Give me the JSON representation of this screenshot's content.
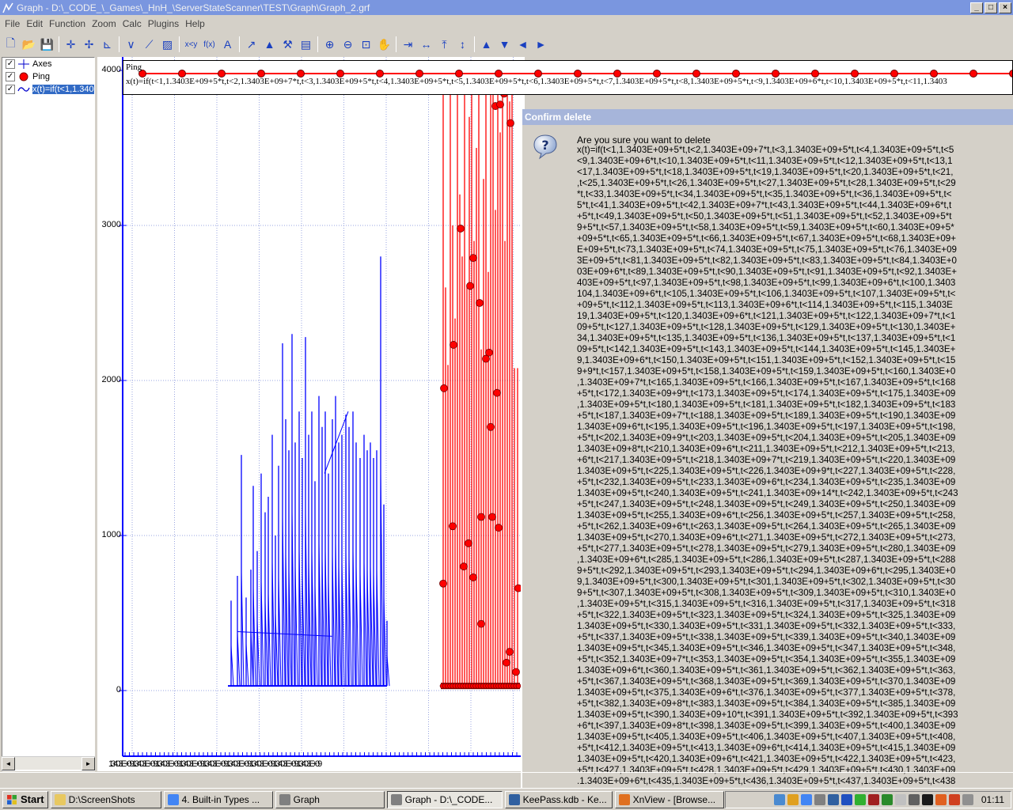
{
  "window": {
    "title": "Graph - D:\\_CODE_\\_Games\\_HnH_\\ServerStateScanner\\TEST\\Graph\\Graph_2.grf",
    "btn_min": "_",
    "btn_max": "□",
    "btn_close": "×"
  },
  "menu": [
    "File",
    "Edit",
    "Function",
    "Zoom",
    "Calc",
    "Plugins",
    "Help"
  ],
  "toolbar": [
    {
      "name": "new-file-icon",
      "glyph": "🗋"
    },
    {
      "name": "open-folder-icon",
      "glyph": "📂"
    },
    {
      "name": "save-icon",
      "glyph": "💾"
    },
    {
      "sep": true
    },
    {
      "name": "axes-icon",
      "glyph": "✛"
    },
    {
      "name": "grid-axes-icon",
      "glyph": "✢"
    },
    {
      "name": "axes-graph-icon",
      "glyph": "⊾"
    },
    {
      "sep": true
    },
    {
      "name": "insert-function-icon",
      "glyph": "∨"
    },
    {
      "name": "insert-tangent-icon",
      "glyph": "⟋"
    },
    {
      "name": "insert-shading-icon",
      "glyph": "▨"
    },
    {
      "sep": true
    },
    {
      "name": "insert-relation-icon",
      "glyph": "x<y"
    },
    {
      "name": "insert-fx-icon",
      "glyph": "f(x)"
    },
    {
      "name": "insert-label-icon",
      "glyph": "A"
    },
    {
      "sep": true
    },
    {
      "name": "trendline-icon",
      "glyph": "↗"
    },
    {
      "name": "point-series-icon",
      "glyph": "▲"
    },
    {
      "name": "custom-icon",
      "glyph": "⚒"
    },
    {
      "name": "table-icon",
      "glyph": "▤"
    },
    {
      "sep": true
    },
    {
      "name": "zoom-in-icon",
      "glyph": "⊕"
    },
    {
      "name": "zoom-out-icon",
      "glyph": "⊖"
    },
    {
      "name": "zoom-window-icon",
      "glyph": "⊡"
    },
    {
      "name": "pan-hand-icon",
      "glyph": "✋"
    },
    {
      "sep": true
    },
    {
      "name": "zoom-x-in-icon",
      "glyph": "⇥"
    },
    {
      "name": "zoom-x-out-icon",
      "glyph": "↔"
    },
    {
      "name": "zoom-y-in-icon",
      "glyph": "⤒"
    },
    {
      "name": "zoom-y-out-icon",
      "glyph": "↕"
    },
    {
      "sep": true
    },
    {
      "name": "move-up-icon",
      "glyph": "▲"
    },
    {
      "name": "move-down-icon",
      "glyph": "▼"
    },
    {
      "name": "move-left-icon",
      "glyph": "◄"
    },
    {
      "name": "move-right-icon",
      "glyph": "►"
    }
  ],
  "legend": [
    {
      "label": "Axes",
      "checked": "✓",
      "icon": "axes-icon"
    },
    {
      "label": "Ping",
      "checked": "✓",
      "icon": "red-dot-icon"
    },
    {
      "label": "x(t)=if(t<1,1.3403",
      "checked": "✓",
      "icon": "wave-icon"
    }
  ],
  "colors": {
    "series_blue": "#0000ff",
    "series_red": "#ff0000",
    "axis": "#0000ff"
  },
  "tooltip": {
    "name": "Ping",
    "expression": "x(t)=if(t<1,1.3403E+09+5*t,t<2,1.3403E+09+7*t,t<3,1.3403E+09+5*t,t<4,1.3403E+09+5*t,t<5,1.3403E+09+5*t,t<6,1.3403E+09+5*t,t<7,1.3403E+09+5*t,t<8,1.3403E+09+5*t,t<9,1.3403E+09+6*t,t<10,1.3403E+09+5*t,t<11,1.3403"
  },
  "chart_data": {
    "type": "scatter",
    "y_ticks": [
      "4000",
      "3000",
      "2000",
      "1000",
      "0"
    ],
    "x_tick_text": "1.3403E+09 1.3403E+09 1.3403E+09 1.3403E+09 1.3403E+09 1.3403E+09 1.3403E+09 1.3403E+09 1.3403E+09",
    "ylim": [
      -420,
      4000
    ],
    "grid": true,
    "blue_spikes": [
      [
        292,
        580
      ],
      [
        300,
        740
      ],
      [
        305,
        1520
      ],
      [
        311,
        600
      ],
      [
        317,
        780
      ],
      [
        320,
        1320
      ],
      [
        325,
        900
      ],
      [
        330,
        1400
      ],
      [
        335,
        1150
      ],
      [
        339,
        1250
      ],
      [
        344,
        1650
      ],
      [
        348,
        1000
      ],
      [
        352,
        1450
      ],
      [
        357,
        2240
      ],
      [
        361,
        1750
      ],
      [
        365,
        1550
      ],
      [
        369,
        2300
      ],
      [
        373,
        1600
      ],
      [
        378,
        1800
      ],
      [
        382,
        1500
      ],
      [
        386,
        2280
      ],
      [
        390,
        1650
      ],
      [
        394,
        1800
      ],
      [
        398,
        1350
      ],
      [
        403,
        1900
      ],
      [
        407,
        1700
      ],
      [
        411,
        1800
      ],
      [
        415,
        1400
      ],
      [
        420,
        1750
      ],
      [
        424,
        1900
      ],
      [
        428,
        1600
      ],
      [
        432,
        1650
      ],
      [
        437,
        1780
      ],
      [
        441,
        1700
      ],
      [
        446,
        1800
      ],
      [
        450,
        1600
      ],
      [
        455,
        1500
      ],
      [
        460,
        1650
      ],
      [
        464,
        1550
      ],
      [
        468,
        1600
      ],
      [
        472,
        1500
      ],
      [
        476,
        1550
      ],
      [
        481,
        2800
      ],
      [
        485,
        1200
      ],
      [
        489,
        450
      ]
    ],
    "red_points": [
      [
        561,
        1950
      ],
      [
        560,
        690
      ],
      [
        572,
        1060
      ],
      [
        573,
        2230
      ],
      [
        582,
        2980
      ],
      [
        586,
        800
      ],
      [
        592,
        950
      ],
      [
        594,
        2610
      ],
      [
        598,
        2790
      ],
      [
        598,
        730
      ],
      [
        606,
        2500
      ],
      [
        608,
        1120
      ],
      [
        608,
        430
      ],
      [
        614,
        2140
      ],
      [
        618,
        2180
      ],
      [
        620,
        1700
      ],
      [
        622,
        1120
      ],
      [
        626,
        3770
      ],
      [
        628,
        1920
      ],
      [
        630,
        1050
      ],
      [
        632,
        3780
      ],
      [
        637,
        3850
      ],
      [
        645,
        3660
      ],
      [
        644,
        250
      ],
      [
        640,
        180
      ],
      [
        652,
        120
      ],
      [
        655,
        660
      ]
    ],
    "red_spikes": [
      [
        560,
        4000
      ],
      [
        563,
        2600
      ],
      [
        566,
        2100
      ],
      [
        569,
        4000
      ],
      [
        572,
        3000
      ],
      [
        575,
        2400
      ],
      [
        578,
        4000
      ],
      [
        581,
        3200
      ],
      [
        584,
        2800
      ],
      [
        587,
        4000
      ],
      [
        590,
        2600
      ],
      [
        593,
        3700
      ],
      [
        596,
        4000
      ],
      [
        599,
        2900
      ],
      [
        602,
        3500
      ],
      [
        605,
        4000
      ],
      [
        608,
        2200
      ],
      [
        611,
        3300
      ],
      [
        614,
        4000
      ],
      [
        617,
        2700
      ],
      [
        620,
        3900
      ],
      [
        623,
        4000
      ],
      [
        626,
        3100
      ],
      [
        629,
        4000
      ],
      [
        632,
        3600
      ],
      [
        635,
        4000
      ],
      [
        638,
        2900
      ],
      [
        641,
        4000
      ],
      [
        644,
        3800
      ],
      [
        647,
        4000
      ],
      [
        650,
        2080
      ],
      [
        654,
        2080
      ]
    ]
  },
  "dialog": {
    "title": "Confirm delete",
    "message": "Are you sure you want to delete",
    "lines": [
      "x(t)=if(t<1,1.3403E+09+5*t,t<2,1.3403E+09+7*t,t<3,1.3403E+09+5*t,t<4,1.3403E+09+5*t,t<5",
      "<9,1.3403E+09+6*t,t<10,1.3403E+09+5*t,t<11,1.3403E+09+5*t,t<12,1.3403E+09+5*t,t<13,1",
      "<17,1.3403E+09+5*t,t<18,1.3403E+09+5*t,t<19,1.3403E+09+5*t,t<20,1.3403E+09+5*t,t<21,",
      ",t<25,1.3403E+09+5*t,t<26,1.3403E+09+5*t,t<27,1.3403E+09+5*t,t<28,1.3403E+09+5*t,t<29",
      "*t,t<33,1.3403E+09+5*t,t<34,1.3403E+09+5*t,t<35,1.3403E+09+5*t,t<36,1.3403E+09+5*t,t<",
      "5*t,t<41,1.3403E+09+5*t,t<42,1.3403E+09+7*t,t<43,1.3403E+09+5*t,t<44,1.3403E+09+6*t,t",
      "+5*t,t<49,1.3403E+09+5*t,t<50,1.3403E+09+5*t,t<51,1.3403E+09+5*t,t<52,1.3403E+09+5*t",
      "9+5*t,t<57,1.3403E+09+5*t,t<58,1.3403E+09+5*t,t<59,1.3403E+09+5*t,t<60,1.3403E+09+5*",
      "+09+5*t,t<65,1.3403E+09+5*t,t<66,1.3403E+09+5*t,t<67,1.3403E+09+5*t,t<68,1.3403E+09+",
      "E+09+5*t,t<73,1.3403E+09+5*t,t<74,1.3403E+09+5*t,t<75,1.3403E+09+5*t,t<76,1.3403E+09",
      "3E+09+5*t,t<81,1.3403E+09+5*t,t<82,1.3403E+09+5*t,t<83,1.3403E+09+5*t,t<84,1.3403E+0",
      "03E+09+6*t,t<89,1.3403E+09+5*t,t<90,1.3403E+09+5*t,t<91,1.3403E+09+5*t,t<92,1.3403E+",
      "403E+09+5*t,t<97,1.3403E+09+5*t,t<98,1.3403E+09+5*t,t<99,1.3403E+09+6*t,t<100,1.3403",
      "104,1.3403E+09+6*t,t<105,1.3403E+09+5*t,t<106,1.3403E+09+5*t,t<107,1.3403E+09+5*t,t<",
      "+09+5*t,t<112,1.3403E+09+5*t,t<113,1.3403E+09+6*t,t<114,1.3403E+09+5*t,t<115,1.3403E",
      "19,1.3403E+09+5*t,t<120,1.3403E+09+6*t,t<121,1.3403E+09+5*t,t<122,1.3403E+09+7*t,t<1",
      "09+5*t,t<127,1.3403E+09+5*t,t<128,1.3403E+09+5*t,t<129,1.3403E+09+5*t,t<130,1.3403E+",
      "34,1.3403E+09+5*t,t<135,1.3403E+09+5*t,t<136,1.3403E+09+5*t,t<137,1.3403E+09+5*t,t<1",
      "09+5*t,t<142,1.3403E+09+5*t,t<143,1.3403E+09+5*t,t<144,1.3403E+09+5*t,t<145,1.3403E+",
      "9,1.3403E+09+6*t,t<150,1.3403E+09+5*t,t<151,1.3403E+09+5*t,t<152,1.3403E+09+5*t,t<15",
      "9+9*t,t<157,1.3403E+09+5*t,t<158,1.3403E+09+5*t,t<159,1.3403E+09+5*t,t<160,1.3403E+0",
      ",1.3403E+09+7*t,t<165,1.3403E+09+5*t,t<166,1.3403E+09+5*t,t<167,1.3403E+09+5*t,t<168",
      "+5*t,t<172,1.3403E+09+9*t,t<173,1.3403E+09+5*t,t<174,1.3403E+09+5*t,t<175,1.3403E+09",
      ",1.3403E+09+5*t,t<180,1.3403E+09+5*t,t<181,1.3403E+09+5*t,t<182,1.3403E+09+5*t,t<183",
      "+5*t,t<187,1.3403E+09+7*t,t<188,1.3403E+09+5*t,t<189,1.3403E+09+5*t,t<190,1.3403E+09",
      "1.3403E+09+6*t,t<195,1.3403E+09+5*t,t<196,1.3403E+09+5*t,t<197,1.3403E+09+5*t,t<198,",
      "+5*t,t<202,1.3403E+09+9*t,t<203,1.3403E+09+5*t,t<204,1.3403E+09+5*t,t<205,1.3403E+09",
      "1.3403E+09+8*t,t<210,1.3403E+09+6*t,t<211,1.3403E+09+5*t,t<212,1.3403E+09+5*t,t<213,",
      "+6*t,t<217,1.3403E+09+5*t,t<218,1.3403E+09+7*t,t<219,1.3403E+09+5*t,t<220,1.3403E+09",
      "1.3403E+09+5*t,t<225,1.3403E+09+5*t,t<226,1.3403E+09+9*t,t<227,1.3403E+09+5*t,t<228,",
      "+5*t,t<232,1.3403E+09+5*t,t<233,1.3403E+09+6*t,t<234,1.3403E+09+5*t,t<235,1.3403E+09",
      "1.3403E+09+5*t,t<240,1.3403E+09+5*t,t<241,1.3403E+09+14*t,t<242,1.3403E+09+5*t,t<243",
      "+5*t,t<247,1.3403E+09+5*t,t<248,1.3403E+09+5*t,t<249,1.3403E+09+5*t,t<250,1.3403E+09",
      "1.3403E+09+5*t,t<255,1.3403E+09+6*t,t<256,1.3403E+09+5*t,t<257,1.3403E+09+5*t,t<258,",
      "+5*t,t<262,1.3403E+09+6*t,t<263,1.3403E+09+5*t,t<264,1.3403E+09+5*t,t<265,1.3403E+09",
      "1.3403E+09+5*t,t<270,1.3403E+09+6*t,t<271,1.3403E+09+5*t,t<272,1.3403E+09+5*t,t<273,",
      "+5*t,t<277,1.3403E+09+5*t,t<278,1.3403E+09+5*t,t<279,1.3403E+09+5*t,t<280,1.3403E+09",
      ",1.3403E+09+6*t,t<285,1.3403E+09+5*t,t<286,1.3403E+09+5*t,t<287,1.3403E+09+5*t,t<288",
      "9+5*t,t<292,1.3403E+09+5*t,t<293,1.3403E+09+5*t,t<294,1.3403E+09+6*t,t<295,1.3403E+0",
      "9,1.3403E+09+5*t,t<300,1.3403E+09+5*t,t<301,1.3403E+09+5*t,t<302,1.3403E+09+5*t,t<30",
      "9+5*t,t<307,1.3403E+09+5*t,t<308,1.3403E+09+5*t,t<309,1.3403E+09+5*t,t<310,1.3403E+0",
      ",1.3403E+09+5*t,t<315,1.3403E+09+5*t,t<316,1.3403E+09+5*t,t<317,1.3403E+09+5*t,t<318",
      "+5*t,t<322,1.3403E+09+5*t,t<323,1.3403E+09+5*t,t<324,1.3403E+09+5*t,t<325,1.3403E+09",
      "1.3403E+09+5*t,t<330,1.3403E+09+5*t,t<331,1.3403E+09+5*t,t<332,1.3403E+09+5*t,t<333,",
      "+5*t,t<337,1.3403E+09+5*t,t<338,1.3403E+09+5*t,t<339,1.3403E+09+5*t,t<340,1.3403E+09",
      "1.3403E+09+5*t,t<345,1.3403E+09+5*t,t<346,1.3403E+09+5*t,t<347,1.3403E+09+5*t,t<348,",
      "+5*t,t<352,1.3403E+09+7*t,t<353,1.3403E+09+5*t,t<354,1.3403E+09+5*t,t<355,1.3403E+09",
      "1.3403E+09+6*t,t<360,1.3403E+09+5*t,t<361,1.3403E+09+5*t,t<362,1.3403E+09+5*t,t<363,",
      "+5*t,t<367,1.3403E+09+5*t,t<368,1.3403E+09+5*t,t<369,1.3403E+09+5*t,t<370,1.3403E+09",
      "1.3403E+09+5*t,t<375,1.3403E+09+6*t,t<376,1.3403E+09+5*t,t<377,1.3403E+09+5*t,t<378,",
      "+5*t,t<382,1.3403E+09+8*t,t<383,1.3403E+09+5*t,t<384,1.3403E+09+5*t,t<385,1.3403E+09",
      "1.3403E+09+5*t,t<390,1.3403E+09+10*t,t<391,1.3403E+09+5*t,t<392,1.3403E+09+5*t,t<393",
      "+6*t,t<397,1.3403E+09+8*t,t<398,1.3403E+09+5*t,t<399,1.3403E+09+5*t,t<400,1.3403E+09",
      "1.3403E+09+5*t,t<405,1.3403E+09+5*t,t<406,1.3403E+09+5*t,t<407,1.3403E+09+5*t,t<408,",
      "+5*t,t<412,1.3403E+09+5*t,t<413,1.3403E+09+6*t,t<414,1.3403E+09+5*t,t<415,1.3403E+09",
      "1.3403E+09+5*t,t<420,1.3403E+09+6*t,t<421,1.3403E+09+5*t,t<422,1.3403E+09+5*t,t<423,",
      "+5*t,t<427,1.3403E+09+5*t,t<428,1.3403E+09+5*t,t<429,1.3403E+09+5*t,t<430,1.3403E+09",
      ".1.3403E+09+6*t,t<435,1.3403E+09+5*t,t<436,1.3403E+09+5*t,t<437,1.3403E+09+5*t,t<438"
    ]
  },
  "taskbar": {
    "start": "Start",
    "buttons": [
      {
        "label": "D:\\ScreenShots",
        "icon": "folder-icon",
        "color": "#e8c860"
      },
      {
        "label": "4. Built-in Types ...",
        "icon": "chrome-icon",
        "color": "#4285f4"
      },
      {
        "label": "Graph",
        "icon": "graph-icon",
        "color": "#808080"
      },
      {
        "label": "Graph - D:\\_CODE...",
        "icon": "graph-icon",
        "color": "#808080"
      },
      {
        "label": "KeePass.kdb - Ke...",
        "icon": "keepass-icon",
        "color": "#3060a0"
      },
      {
        "label": "XnView - [Browse...",
        "icon": "xnview-icon",
        "color": "#e07020"
      }
    ],
    "clock": "01:11"
  }
}
